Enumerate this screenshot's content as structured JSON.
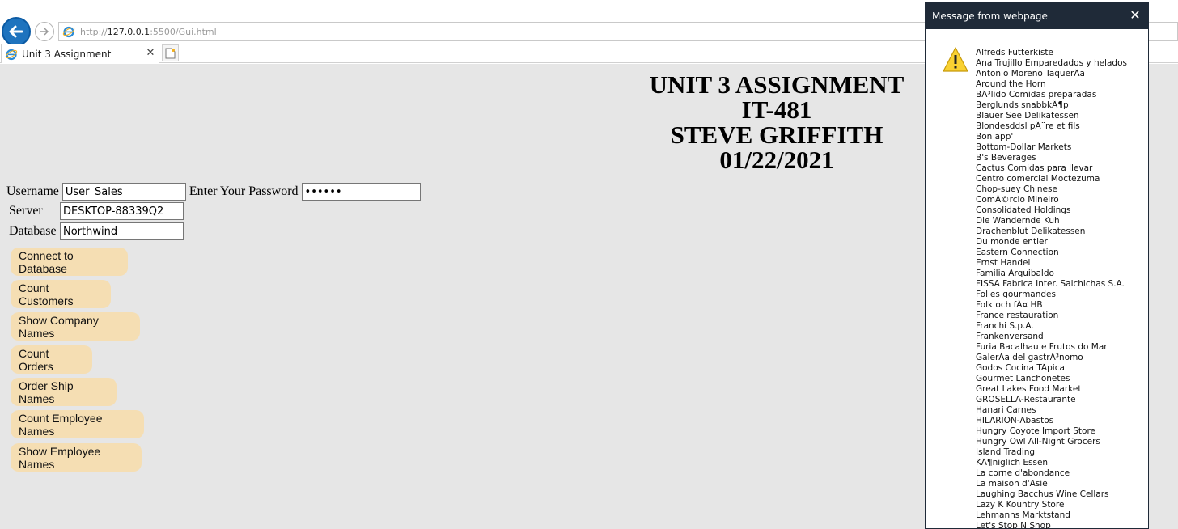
{
  "browser": {
    "url_prefix": "http://",
    "url_host": "127.0.0.1",
    "url_rest": ":5500/Gui.html",
    "tab_title": "Unit 3 Assignment"
  },
  "page": {
    "heading": [
      "UNIT 3 ASSIGNMENT",
      "IT-481",
      "STEVE GRIFFITH",
      "01/22/2021"
    ],
    "form": {
      "username_label": "Username",
      "username_value": "User_Sales",
      "password_label": "Enter Your Password",
      "password_value": "••••••",
      "server_label": "Server",
      "server_value": "DESKTOP-88339Q2",
      "database_label": "Database",
      "database_value": "Northwind"
    },
    "buttons": [
      "Connect to Database",
      "Count Customers",
      "Show Company Names",
      "Count Orders",
      "Order Ship Names",
      "Count Employee Names",
      "Show Employee Names"
    ]
  },
  "dialog": {
    "title": "Message from webpage",
    "icon": "warning-icon",
    "lines": [
      " Alfreds Futterkiste",
      "Ana Trujillo Emparedados y helados",
      "Antonio Moreno TaquerÃ­a",
      "Around the Horn",
      "BÃ³lido Comidas preparadas",
      "Berglunds snabbkÃ¶p",
      "Blauer See Delikatessen",
      "Blondesddsl pÃ¨re et fils",
      "Bon app'",
      "Bottom-Dollar Markets",
      "B's Beverages",
      "Cactus Comidas para llevar",
      "Centro comercial Moctezuma",
      "Chop-suey Chinese",
      "ComÃ©rcio Mineiro",
      "Consolidated Holdings",
      "Die Wandernde Kuh",
      "Drachenblut Delikatessen",
      "Du monde entier",
      "Eastern Connection",
      "Ernst Handel",
      "Familia Arquibaldo",
      "FISSA Fabrica Inter. Salchichas S.A.",
      "Folies gourmandes",
      "Folk och fÃ¤ HB",
      "France restauration",
      "Franchi S.p.A.",
      "Frankenversand",
      "Furia Bacalhau e Frutos do Mar",
      "GalerÃ­a del gastrÃ³nomo",
      "Godos Cocina TÃ­pica",
      "Gourmet Lanchonetes",
      "Great Lakes Food Market",
      "GROSELLA-Restaurante",
      "Hanari Carnes",
      "HILARION-Abastos",
      "Hungry Coyote Import Store",
      "Hungry Owl All-Night Grocers",
      "Island Trading",
      "KÃ¶niglich Essen",
      "La corne d'abondance",
      "La maison d'Asie",
      "Laughing Bacchus Wine Cellars",
      "Lazy K Kountry Store",
      "Lehmanns Marktstand",
      "Let's Stop N Shop"
    ]
  }
}
